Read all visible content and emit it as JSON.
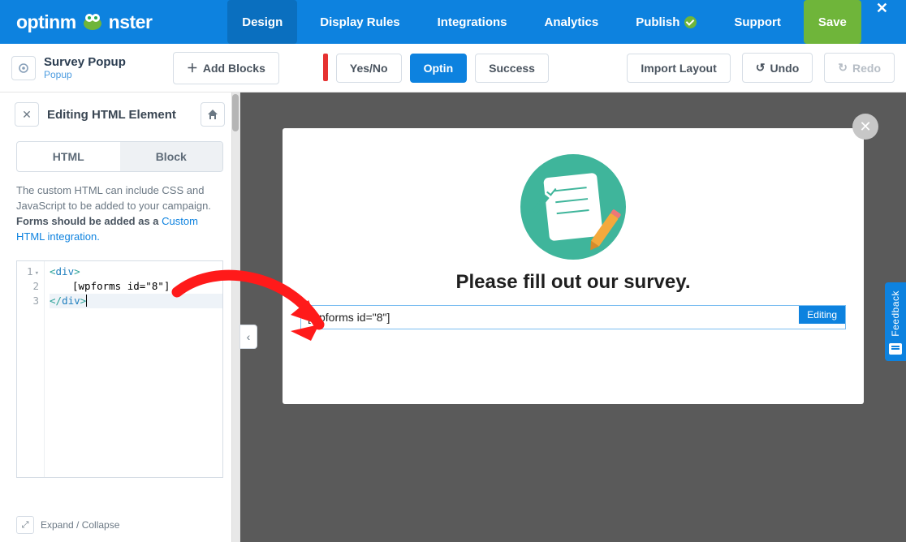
{
  "brand": {
    "name_pre": "optinm",
    "name_post": "nster"
  },
  "nav": {
    "design": "Design",
    "display_rules": "Display Rules",
    "integrations": "Integrations",
    "analytics": "Analytics",
    "publish": "Publish",
    "support": "Support",
    "save": "Save"
  },
  "campaign": {
    "title": "Survey Popup",
    "subtitle": "Popup"
  },
  "toolbar": {
    "add_blocks": "Add Blocks",
    "mode_yesno": "Yes/No",
    "mode_optin": "Optin",
    "mode_success": "Success",
    "import_layout": "Import Layout",
    "undo": "Undo",
    "redo": "Redo"
  },
  "sidebar": {
    "header": "Editing HTML Element",
    "tabs": {
      "html": "HTML",
      "block": "Block"
    },
    "desc_pre": "The custom HTML can include CSS and JavaScript to be added to your campaign. ",
    "desc_bold": "Forms should be added as a ",
    "desc_link": "Custom HTML integration.",
    "code": {
      "l1_open_br": "<",
      "l1_tag": "div",
      "l1_close_br": ">",
      "l2_text": "[wpforms id=\"8\"]",
      "l3_open_br": "</",
      "l3_tag": "div",
      "l3_close_br": ">"
    },
    "lines": {
      "l1": "1",
      "l2": "2",
      "l3": "3"
    },
    "expand": "Expand / Collapse"
  },
  "popup": {
    "heading": "Please fill out our survey.",
    "shortcode": "[wpforms id=\"8\"]",
    "badge": "Editing"
  },
  "feedback": "Feedback"
}
